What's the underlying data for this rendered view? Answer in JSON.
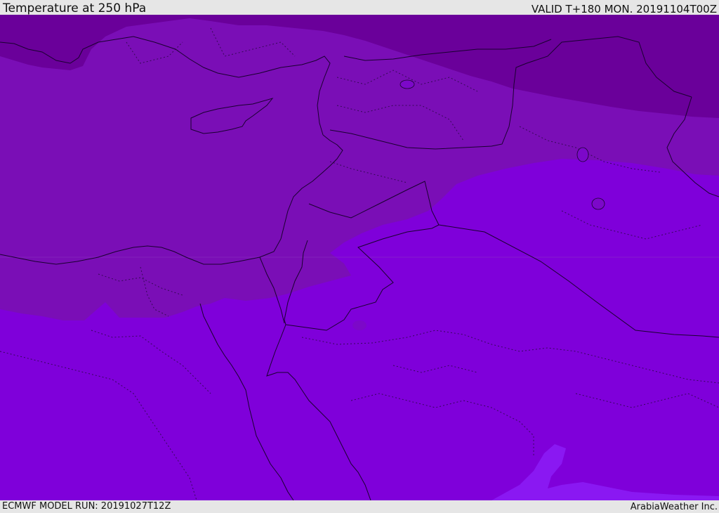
{
  "header": {
    "title": "Temperature at 250 hPa",
    "valid": "VALID T+180 MON. 20191104T00Z"
  },
  "footer": {
    "model_run": "ECMWF MODEL RUN: 20191027T12Z",
    "credit": "ArabiaWeather Inc."
  },
  "map": {
    "region": "Eastern Mediterranean / Middle East",
    "colors": {
      "coldest_band": "#6a009a",
      "cold_band": "#7a0eb6",
      "mid_band": "#7f00da",
      "warm_patch": "#8a18f2"
    },
    "boundaries": {
      "coastline": "solid",
      "country_borders": "solid",
      "subdivisions": "dotted"
    }
  }
}
